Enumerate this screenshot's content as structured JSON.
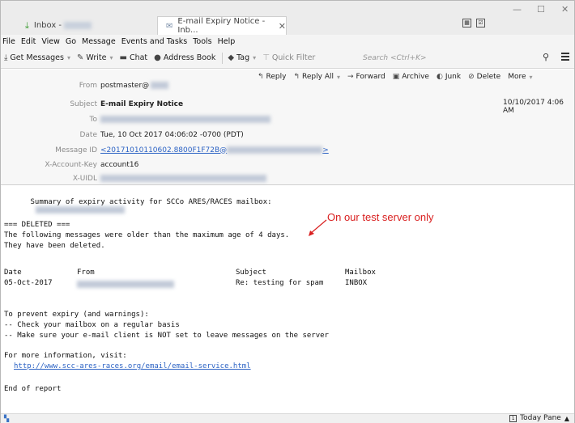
{
  "tabs": [
    {
      "label": "Inbox -"
    },
    {
      "label": "E-mail Expiry Notice - Inb..."
    }
  ],
  "menu": [
    "File",
    "Edit",
    "View",
    "Go",
    "Message",
    "Events and Tasks",
    "Tools",
    "Help"
  ],
  "toolbar": {
    "get_messages": "Get Messages",
    "write": "Write",
    "chat": "Chat",
    "address_book": "Address Book",
    "tag": "Tag",
    "quick_filter": "Quick Filter",
    "search_placeholder": "Search <Ctrl+K>"
  },
  "header_actions": {
    "reply": "Reply",
    "reply_all": "Reply All",
    "forward": "Forward",
    "archive": "Archive",
    "junk": "Junk",
    "delete": "Delete",
    "more": "More"
  },
  "header": {
    "from_label": "From",
    "from_value": "postmaster@",
    "subject_label": "Subject",
    "subject_value": "E-mail Expiry Notice",
    "to_label": "To",
    "date_label": "Date",
    "date_value": "Tue, 10 Oct 2017 04:06:02 -0700 (PDT)",
    "message_id_label": "Message ID",
    "message_id_value": "<20171010110602.8800F1F72B@",
    "message_id_end": ">",
    "account_key_label": "X-Account-Key",
    "account_key_value": "account16",
    "uidl_label": "X-UIDL",
    "received_date": "10/10/2017 4:06 AM"
  },
  "body": {
    "summary": "Summary of expiry activity for SCCo ARES/RACES mailbox:",
    "deleted_header": "=== DELETED ===",
    "line1": "The following messages were older than the maximum age of 4 days.",
    "line2": "They have been deleted.",
    "col_date": "Date",
    "col_from": "From",
    "col_subject": "Subject",
    "col_mailbox": "Mailbox",
    "row_date": "05-Oct-2017",
    "row_subject": "Re: testing for spam",
    "row_mailbox": "INBOX",
    "prevent": "To prevent expiry (and warnings):",
    "tip1": "-- Check your mailbox on a regular basis",
    "tip2": "-- Make sure your e-mail client is NOT set to leave messages on the server",
    "more_info": "For more information, visit:",
    "url": "http://www.scc-ares-races.org/email/email-service.html",
    "end": "End of report"
  },
  "annotation": "On our test server only",
  "status": {
    "today_pane": "Today Pane"
  },
  "colors": {
    "link": "#2b62c4",
    "annotation": "#d92020"
  }
}
